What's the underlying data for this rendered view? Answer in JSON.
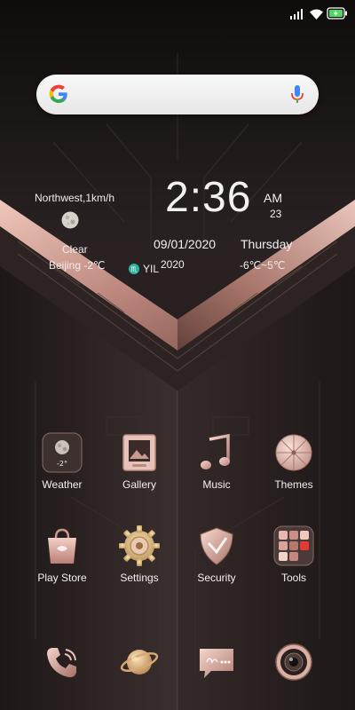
{
  "status_bar": {
    "icons": [
      "signal-icon",
      "wifi-icon",
      "battery-charging-icon"
    ]
  },
  "search": {
    "logo": "google-g-icon",
    "mic": "mic-icon"
  },
  "weather_widget": {
    "wind": "Northwest,1km/h",
    "condition": "Clear",
    "location_temp": "Beijing -2℃",
    "time": "2:36",
    "ampm": "AM",
    "seconds": "23",
    "date": "09/01/2020",
    "weekday": "Thursday",
    "zodiac": "YIL",
    "year": "2020",
    "temp_range": "-6℃~5℃"
  },
  "apps": [
    {
      "label": "Weather",
      "icon": "moon-weather-icon"
    },
    {
      "label": "Gallery",
      "icon": "picture-frame-icon"
    },
    {
      "label": "Music",
      "icon": "music-note-icon"
    },
    {
      "label": "Themes",
      "icon": "umbrella-icon"
    },
    {
      "label": "Play Store",
      "icon": "shopping-bag-icon"
    },
    {
      "label": "Settings",
      "icon": "gear-icon"
    },
    {
      "label": "Security",
      "icon": "shield-icon"
    },
    {
      "label": "Tools",
      "icon": "folder-icon"
    }
  ],
  "weather_icon_value": "-2°",
  "dock": [
    {
      "icon": "phone-icon"
    },
    {
      "icon": "planet-browser-icon"
    },
    {
      "icon": "message-bubble-icon"
    },
    {
      "icon": "camera-lens-icon"
    }
  ],
  "colors": {
    "background": "#1b1616",
    "rose_gold": "#d9a9a0",
    "text": "#f4f0f0"
  }
}
